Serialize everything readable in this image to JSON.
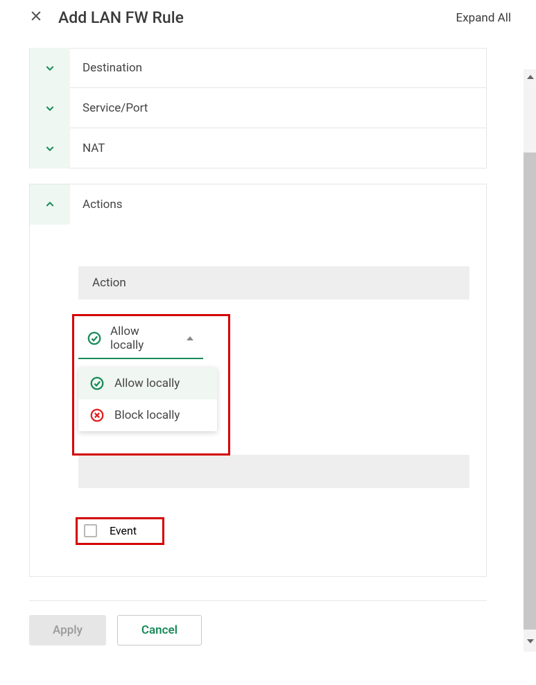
{
  "header": {
    "title": "Add LAN FW Rule",
    "expand_all": "Expand All"
  },
  "sections": {
    "destination": "Destination",
    "service_port": "Service/Port",
    "nat": "NAT",
    "actions": "Actions"
  },
  "actions_panel": {
    "action_heading": "Action",
    "dropdown_selected": "Allow locally",
    "dropdown_options": {
      "allow": "Allow locally",
      "block": "Block locally"
    },
    "event_label": "Event"
  },
  "footer": {
    "apply": "Apply",
    "cancel": "Cancel"
  },
  "colors": {
    "accent_green": "#188a58",
    "highlight_red": "#d40000",
    "deny_red": "#e02020"
  }
}
